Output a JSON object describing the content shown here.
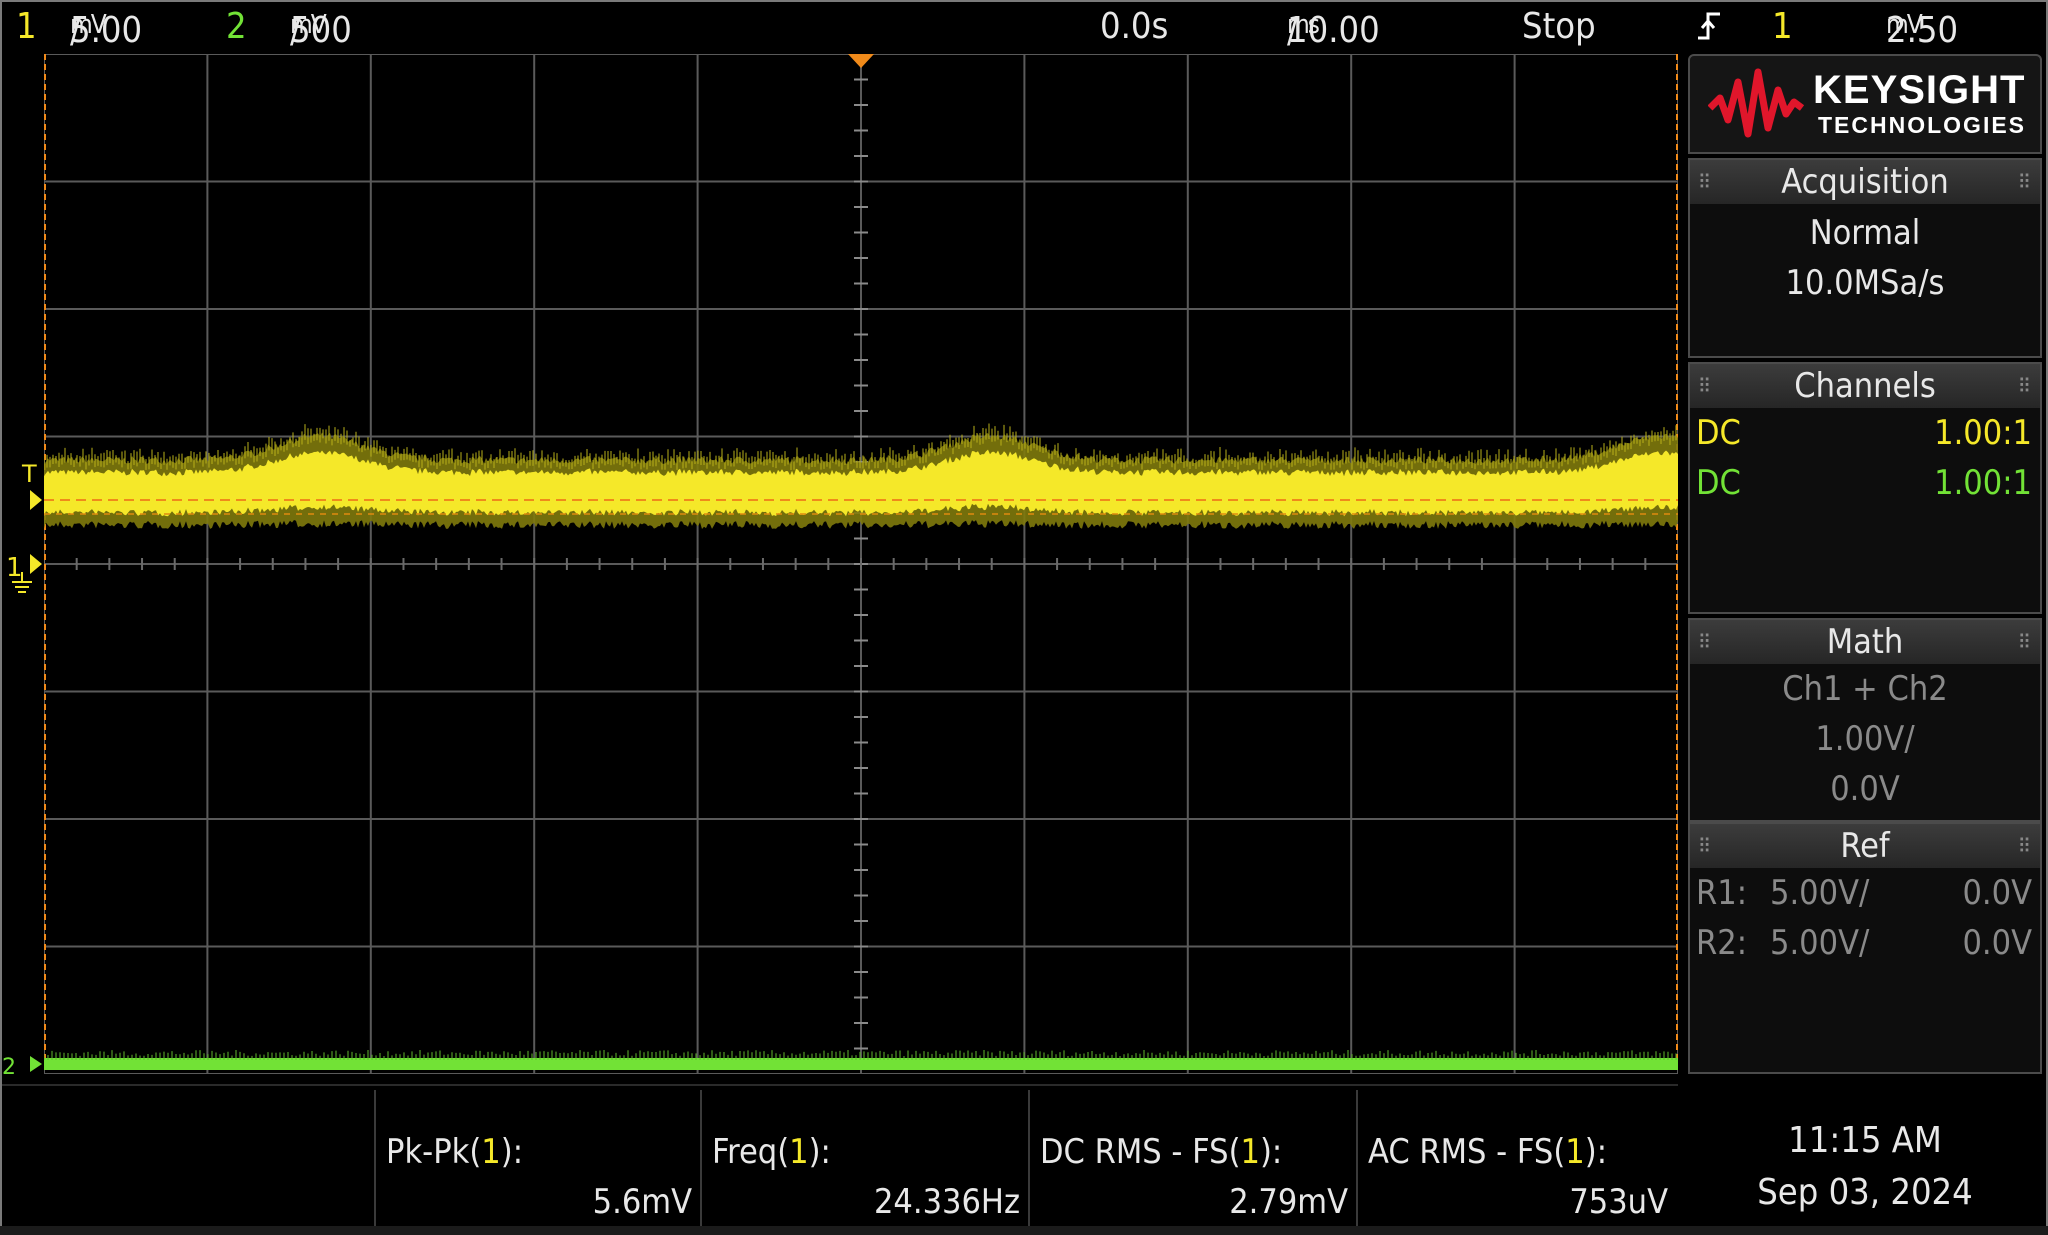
{
  "topbar": {
    "ch1_num": "1",
    "ch1_scale": "5.00",
    "ch1_unit": "mV",
    "ch2_num": "2",
    "ch2_scale": "500",
    "ch2_unit": "mV",
    "slash": "/",
    "time_delay": "0.0s",
    "time_scale": "10.00",
    "time_unit": "ms",
    "run_state": "Stop",
    "trigger_edge_icon": "rising-edge-trigger-icon",
    "trigger_source": "1",
    "trigger_level": "2.50",
    "trigger_unit": "mV"
  },
  "logo": {
    "brand": "KEYSIGHT",
    "sub": "TECHNOLOGIES"
  },
  "acquisition": {
    "title": "Acquisition",
    "mode": "Normal",
    "rate": "10.0MSa/s"
  },
  "channels": {
    "title": "Channels",
    "rows": [
      {
        "coupling": "DC",
        "probe": "1.00:1"
      },
      {
        "coupling": "DC",
        "probe": "1.00:1"
      }
    ]
  },
  "math": {
    "title": "Math",
    "expr": "Ch1 + Ch2",
    "scale": "1.00V/",
    "offset": "0.0V"
  },
  "ref": {
    "title": "Ref",
    "rows": [
      {
        "name": "R1:",
        "scale": "5.00V/",
        "offset": "0.0V"
      },
      {
        "name": "R2:",
        "scale": "5.00V/",
        "offset": "0.0V"
      }
    ]
  },
  "markers": {
    "trigger_T": "T",
    "ch1_ground": "1",
    "ch2_ground": "2"
  },
  "measurements": [
    {
      "label": "Pk-Pk(",
      "ch": "1",
      "close": "):",
      "value": "5.6mV"
    },
    {
      "label": "Freq(",
      "ch": "1",
      "close": "):",
      "value": "24.336Hz"
    },
    {
      "label": "DC RMS - FS(",
      "ch": "1",
      "close": "):",
      "value": "2.79mV"
    },
    {
      "label": "AC RMS - FS(",
      "ch": "1",
      "close": "):",
      "value": "753uV"
    }
  ],
  "clock": {
    "time": "11:15 AM",
    "date": "Sep 03, 2024"
  },
  "colors": {
    "ch1": "#f5e829",
    "ch2": "#72e236",
    "trigger": "#f08a1a",
    "grid": "#5a5a5a"
  },
  "waveform": {
    "ch1_ripple_frequency_hz": 24.336,
    "ch1_pk_pk_mv": 5.6
  }
}
